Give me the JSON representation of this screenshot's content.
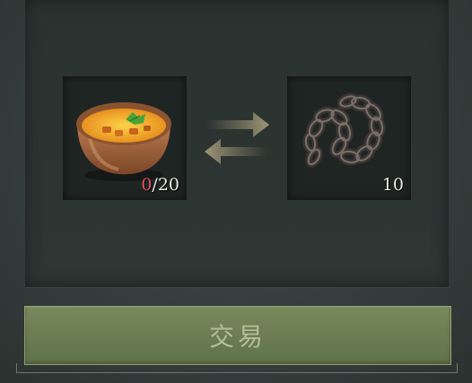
{
  "trade": {
    "give_item": {
      "icon": "soup-bowl-icon",
      "count_have": "0",
      "count_need": "/20"
    },
    "receive_item": {
      "icon": "chain-icon",
      "count": "10"
    },
    "exchange_icon": "swap-arrows-icon",
    "button_label": "交易"
  },
  "colors": {
    "button_bg": "#6f8154",
    "insufficient": "#e05a58",
    "panel_bg": "#2d3533"
  }
}
